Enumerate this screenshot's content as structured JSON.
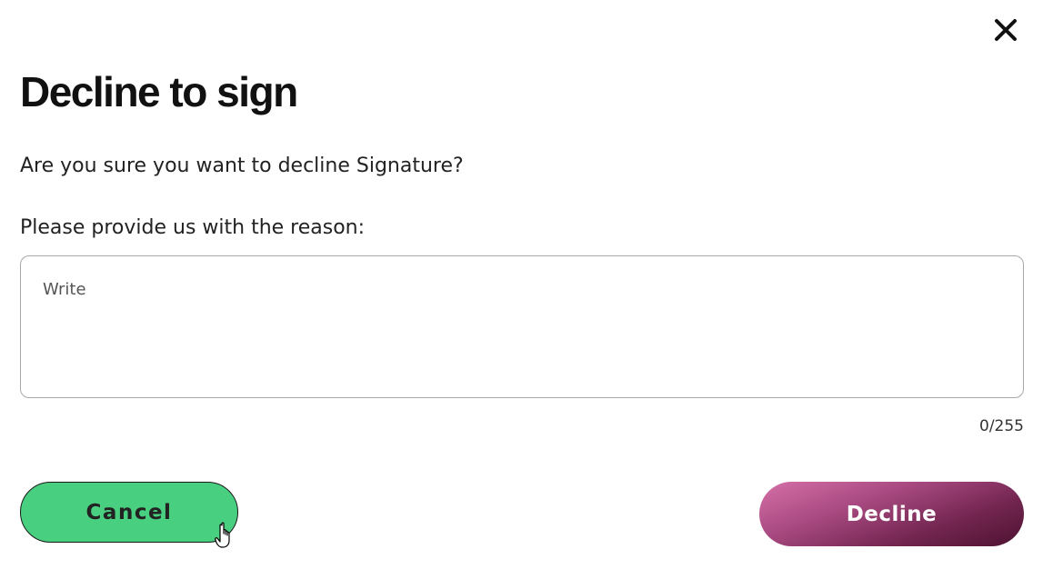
{
  "dialog": {
    "title": "Decline to sign",
    "question": "Are you sure you want to decline Signature?",
    "reason_label": "Please provide us with the reason:",
    "reason_value": "",
    "reason_placeholder": "Write",
    "counter": "0/255",
    "close_icon": "close-icon"
  },
  "buttons": {
    "cancel_label": "Cancel",
    "decline_label": "Decline"
  },
  "colors": {
    "cancel_bg": "#48cf7f",
    "decline_gradient_start": "#d670a8",
    "decline_gradient_end": "#4d1231",
    "title": "#111111"
  }
}
